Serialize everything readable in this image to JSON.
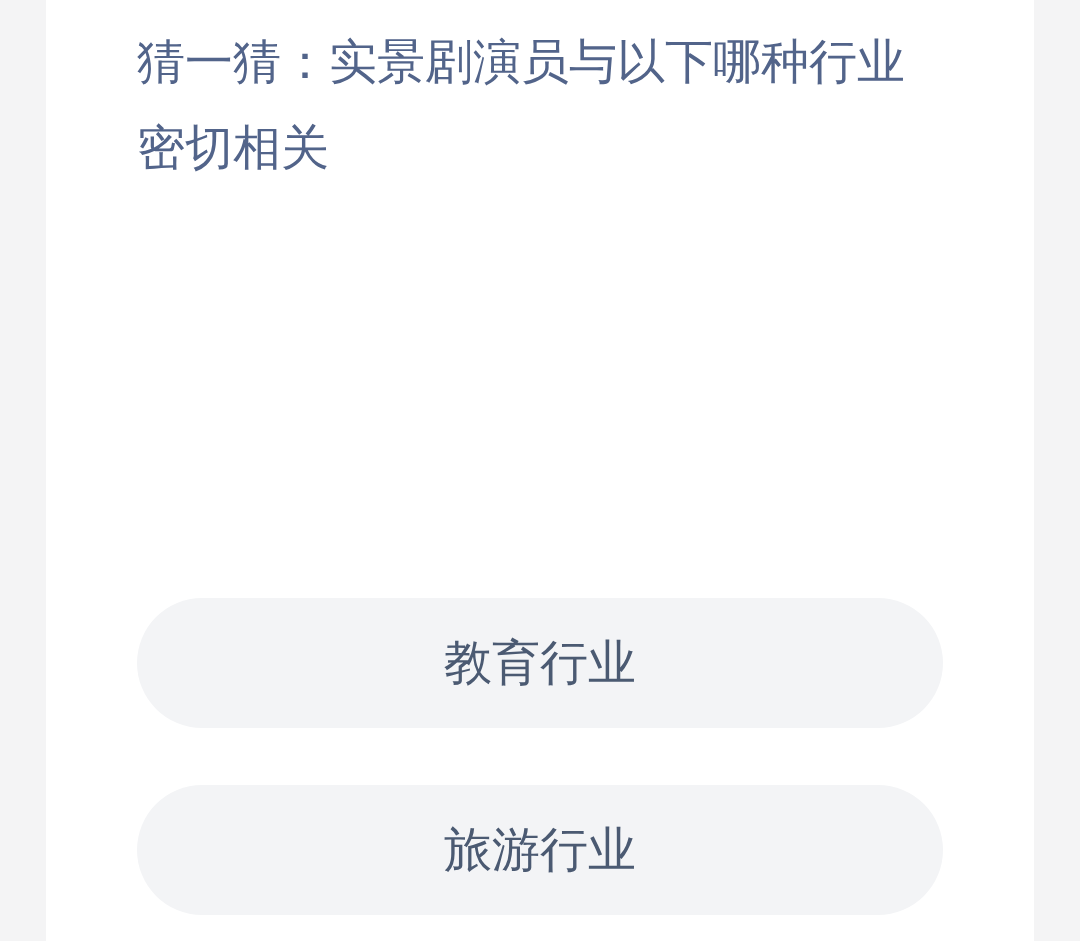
{
  "question": "猜一猜：实景剧演员与以下哪种行业密切相关",
  "options": [
    {
      "label": "教育行业"
    },
    {
      "label": "旅游行业"
    }
  ]
}
